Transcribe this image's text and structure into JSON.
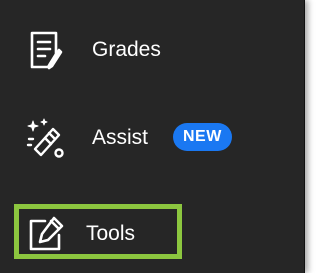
{
  "nav": {
    "items": [
      {
        "label": "Grades",
        "icon": "grades-icon"
      },
      {
        "label": "Assist",
        "icon": "assist-icon",
        "badge": "NEW"
      },
      {
        "label": "Tools",
        "icon": "tools-icon"
      }
    ]
  },
  "colors": {
    "panel_bg": "#262626",
    "badge_bg": "#1a78f2",
    "highlight": "#8cc63f",
    "text": "#ffffff"
  }
}
